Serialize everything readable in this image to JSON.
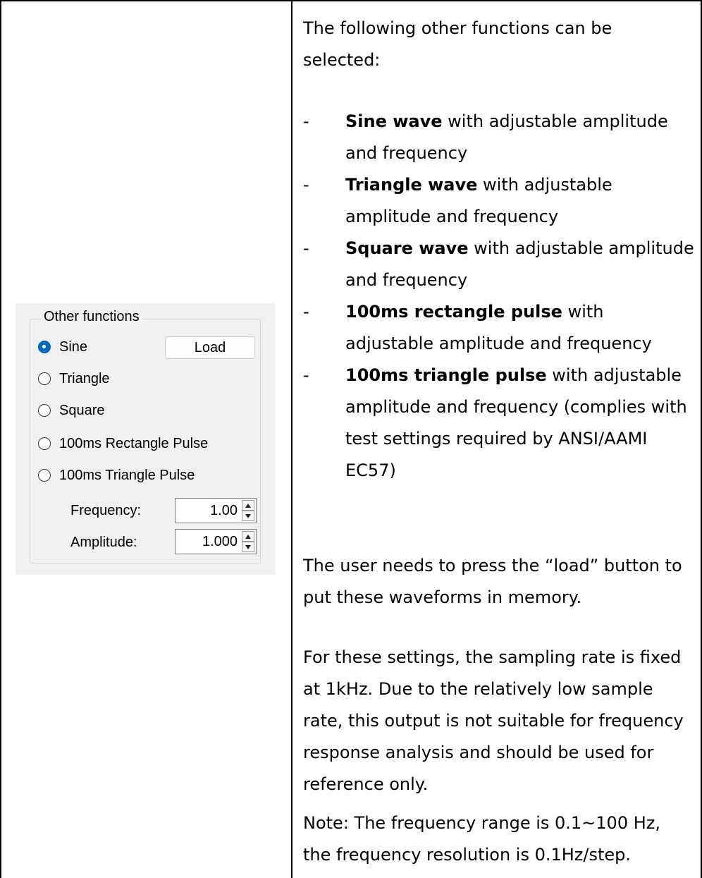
{
  "panel": {
    "group_title": "Other functions",
    "load_label": "Load",
    "options": [
      {
        "label": "Sine",
        "selected": true
      },
      {
        "label": "Triangle",
        "selected": false
      },
      {
        "label": "Square",
        "selected": false
      },
      {
        "label": "100ms Rectangle Pulse",
        "selected": false
      },
      {
        "label": "100ms Triangle Pulse",
        "selected": false
      }
    ],
    "frequency": {
      "label": "Frequency:",
      "value": "1.00"
    },
    "amplitude": {
      "label": "Amplitude:",
      "value": "1.000"
    },
    "accent_color": "#0067c0"
  },
  "doc": {
    "intro": "The following other functions can be selected:",
    "bullets": [
      {
        "bold": "Sine wave",
        "rest": " with adjustable amplitude and frequency"
      },
      {
        "bold": "Triangle wave",
        "rest": " with adjustable amplitude and frequency"
      },
      {
        "bold": "Square wave",
        "rest": " with adjustable amplitude and frequency"
      },
      {
        "bold": "100ms rectangle pulse",
        "rest": " with adjustable amplitude and frequency"
      },
      {
        "bold": "100ms triangle pulse",
        "rest": " with adjustable amplitude and frequency (complies with test settings required by ANSI/AAMI EC57)"
      }
    ],
    "load_note": "The user needs to press the “load” button to put these waveforms in memory.",
    "sampling_note": "For these settings, the sampling rate is fixed at 1kHz. Due to the relatively low sample rate, this output is not suitable for frequency response analysis and should be used for reference only.",
    "range_note": "Note: The frequency range is 0.1~100 Hz, the frequency resolution is 0.1Hz/step.",
    "bullet_dash": "-"
  }
}
